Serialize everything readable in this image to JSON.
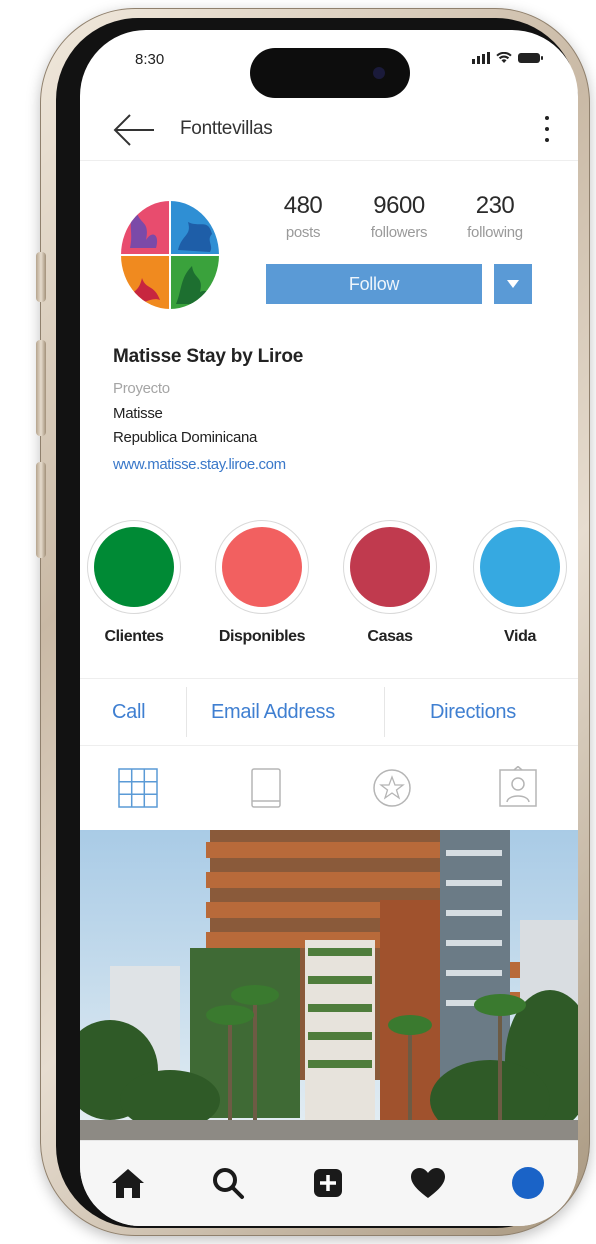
{
  "status_bar": {
    "time": "8:30"
  },
  "header": {
    "username": "Fonttevillas",
    "back_icon": "arrow-left-icon",
    "more_icon": "more-vertical-icon"
  },
  "profile": {
    "stats": [
      {
        "value": "480",
        "label": "posts"
      },
      {
        "value": "9600",
        "label": "followers"
      },
      {
        "value": "230",
        "label": "following"
      }
    ],
    "follow_label": "Follow",
    "name": "Matisse Stay by Liroe",
    "category": "Proyecto",
    "bio_lines": [
      "Matisse",
      "Republica Dominicana"
    ],
    "link": "www.matisse.stay.liroe.com"
  },
  "highlights": [
    {
      "label": "Clientes",
      "color": "#008a35"
    },
    {
      "label": "Disponibles",
      "color": "#f26060"
    },
    {
      "label": "Casas",
      "color": "#c03a4e"
    },
    {
      "label": "Vida",
      "color": "#36a9e1"
    }
  ],
  "contact": {
    "call": "Call",
    "email": "Email Address",
    "directions": "Directions"
  },
  "tabs": [
    "grid-icon",
    "igtv-icon",
    "star-icon",
    "tagged-user-icon"
  ],
  "bottom_nav": [
    "home-icon",
    "search-icon",
    "add-post-icon",
    "heart-icon",
    "profile-avatar"
  ],
  "colors": {
    "accent": "#5a9ad6",
    "link": "#3f7fd1",
    "profile_dot": "#1a63c7"
  }
}
